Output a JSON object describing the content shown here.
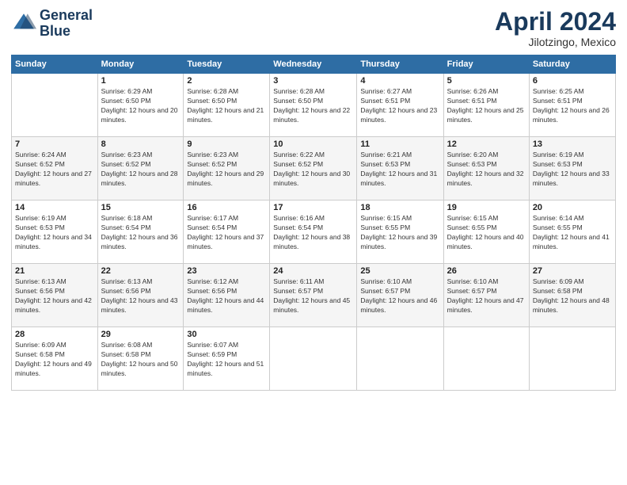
{
  "logo": {
    "line1": "General",
    "line2": "Blue"
  },
  "title": "April 2024",
  "location": "Jilotzingo, Mexico",
  "weekdays": [
    "Sunday",
    "Monday",
    "Tuesday",
    "Wednesday",
    "Thursday",
    "Friday",
    "Saturday"
  ],
  "weeks": [
    [
      {
        "day": "",
        "sunrise": "",
        "sunset": "",
        "daylight": ""
      },
      {
        "day": "1",
        "sunrise": "Sunrise: 6:29 AM",
        "sunset": "Sunset: 6:50 PM",
        "daylight": "Daylight: 12 hours and 20 minutes."
      },
      {
        "day": "2",
        "sunrise": "Sunrise: 6:28 AM",
        "sunset": "Sunset: 6:50 PM",
        "daylight": "Daylight: 12 hours and 21 minutes."
      },
      {
        "day": "3",
        "sunrise": "Sunrise: 6:28 AM",
        "sunset": "Sunset: 6:50 PM",
        "daylight": "Daylight: 12 hours and 22 minutes."
      },
      {
        "day": "4",
        "sunrise": "Sunrise: 6:27 AM",
        "sunset": "Sunset: 6:51 PM",
        "daylight": "Daylight: 12 hours and 23 minutes."
      },
      {
        "day": "5",
        "sunrise": "Sunrise: 6:26 AM",
        "sunset": "Sunset: 6:51 PM",
        "daylight": "Daylight: 12 hours and 25 minutes."
      },
      {
        "day": "6",
        "sunrise": "Sunrise: 6:25 AM",
        "sunset": "Sunset: 6:51 PM",
        "daylight": "Daylight: 12 hours and 26 minutes."
      }
    ],
    [
      {
        "day": "7",
        "sunrise": "Sunrise: 6:24 AM",
        "sunset": "Sunset: 6:52 PM",
        "daylight": "Daylight: 12 hours and 27 minutes."
      },
      {
        "day": "8",
        "sunrise": "Sunrise: 6:23 AM",
        "sunset": "Sunset: 6:52 PM",
        "daylight": "Daylight: 12 hours and 28 minutes."
      },
      {
        "day": "9",
        "sunrise": "Sunrise: 6:23 AM",
        "sunset": "Sunset: 6:52 PM",
        "daylight": "Daylight: 12 hours and 29 minutes."
      },
      {
        "day": "10",
        "sunrise": "Sunrise: 6:22 AM",
        "sunset": "Sunset: 6:52 PM",
        "daylight": "Daylight: 12 hours and 30 minutes."
      },
      {
        "day": "11",
        "sunrise": "Sunrise: 6:21 AM",
        "sunset": "Sunset: 6:53 PM",
        "daylight": "Daylight: 12 hours and 31 minutes."
      },
      {
        "day": "12",
        "sunrise": "Sunrise: 6:20 AM",
        "sunset": "Sunset: 6:53 PM",
        "daylight": "Daylight: 12 hours and 32 minutes."
      },
      {
        "day": "13",
        "sunrise": "Sunrise: 6:19 AM",
        "sunset": "Sunset: 6:53 PM",
        "daylight": "Daylight: 12 hours and 33 minutes."
      }
    ],
    [
      {
        "day": "14",
        "sunrise": "Sunrise: 6:19 AM",
        "sunset": "Sunset: 6:53 PM",
        "daylight": "Daylight: 12 hours and 34 minutes."
      },
      {
        "day": "15",
        "sunrise": "Sunrise: 6:18 AM",
        "sunset": "Sunset: 6:54 PM",
        "daylight": "Daylight: 12 hours and 36 minutes."
      },
      {
        "day": "16",
        "sunrise": "Sunrise: 6:17 AM",
        "sunset": "Sunset: 6:54 PM",
        "daylight": "Daylight: 12 hours and 37 minutes."
      },
      {
        "day": "17",
        "sunrise": "Sunrise: 6:16 AM",
        "sunset": "Sunset: 6:54 PM",
        "daylight": "Daylight: 12 hours and 38 minutes."
      },
      {
        "day": "18",
        "sunrise": "Sunrise: 6:15 AM",
        "sunset": "Sunset: 6:55 PM",
        "daylight": "Daylight: 12 hours and 39 minutes."
      },
      {
        "day": "19",
        "sunrise": "Sunrise: 6:15 AM",
        "sunset": "Sunset: 6:55 PM",
        "daylight": "Daylight: 12 hours and 40 minutes."
      },
      {
        "day": "20",
        "sunrise": "Sunrise: 6:14 AM",
        "sunset": "Sunset: 6:55 PM",
        "daylight": "Daylight: 12 hours and 41 minutes."
      }
    ],
    [
      {
        "day": "21",
        "sunrise": "Sunrise: 6:13 AM",
        "sunset": "Sunset: 6:56 PM",
        "daylight": "Daylight: 12 hours and 42 minutes."
      },
      {
        "day": "22",
        "sunrise": "Sunrise: 6:13 AM",
        "sunset": "Sunset: 6:56 PM",
        "daylight": "Daylight: 12 hours and 43 minutes."
      },
      {
        "day": "23",
        "sunrise": "Sunrise: 6:12 AM",
        "sunset": "Sunset: 6:56 PM",
        "daylight": "Daylight: 12 hours and 44 minutes."
      },
      {
        "day": "24",
        "sunrise": "Sunrise: 6:11 AM",
        "sunset": "Sunset: 6:57 PM",
        "daylight": "Daylight: 12 hours and 45 minutes."
      },
      {
        "day": "25",
        "sunrise": "Sunrise: 6:10 AM",
        "sunset": "Sunset: 6:57 PM",
        "daylight": "Daylight: 12 hours and 46 minutes."
      },
      {
        "day": "26",
        "sunrise": "Sunrise: 6:10 AM",
        "sunset": "Sunset: 6:57 PM",
        "daylight": "Daylight: 12 hours and 47 minutes."
      },
      {
        "day": "27",
        "sunrise": "Sunrise: 6:09 AM",
        "sunset": "Sunset: 6:58 PM",
        "daylight": "Daylight: 12 hours and 48 minutes."
      }
    ],
    [
      {
        "day": "28",
        "sunrise": "Sunrise: 6:09 AM",
        "sunset": "Sunset: 6:58 PM",
        "daylight": "Daylight: 12 hours and 49 minutes."
      },
      {
        "day": "29",
        "sunrise": "Sunrise: 6:08 AM",
        "sunset": "Sunset: 6:58 PM",
        "daylight": "Daylight: 12 hours and 50 minutes."
      },
      {
        "day": "30",
        "sunrise": "Sunrise: 6:07 AM",
        "sunset": "Sunset: 6:59 PM",
        "daylight": "Daylight: 12 hours and 51 minutes."
      },
      {
        "day": "",
        "sunrise": "",
        "sunset": "",
        "daylight": ""
      },
      {
        "day": "",
        "sunrise": "",
        "sunset": "",
        "daylight": ""
      },
      {
        "day": "",
        "sunrise": "",
        "sunset": "",
        "daylight": ""
      },
      {
        "day": "",
        "sunrise": "",
        "sunset": "",
        "daylight": ""
      }
    ]
  ]
}
